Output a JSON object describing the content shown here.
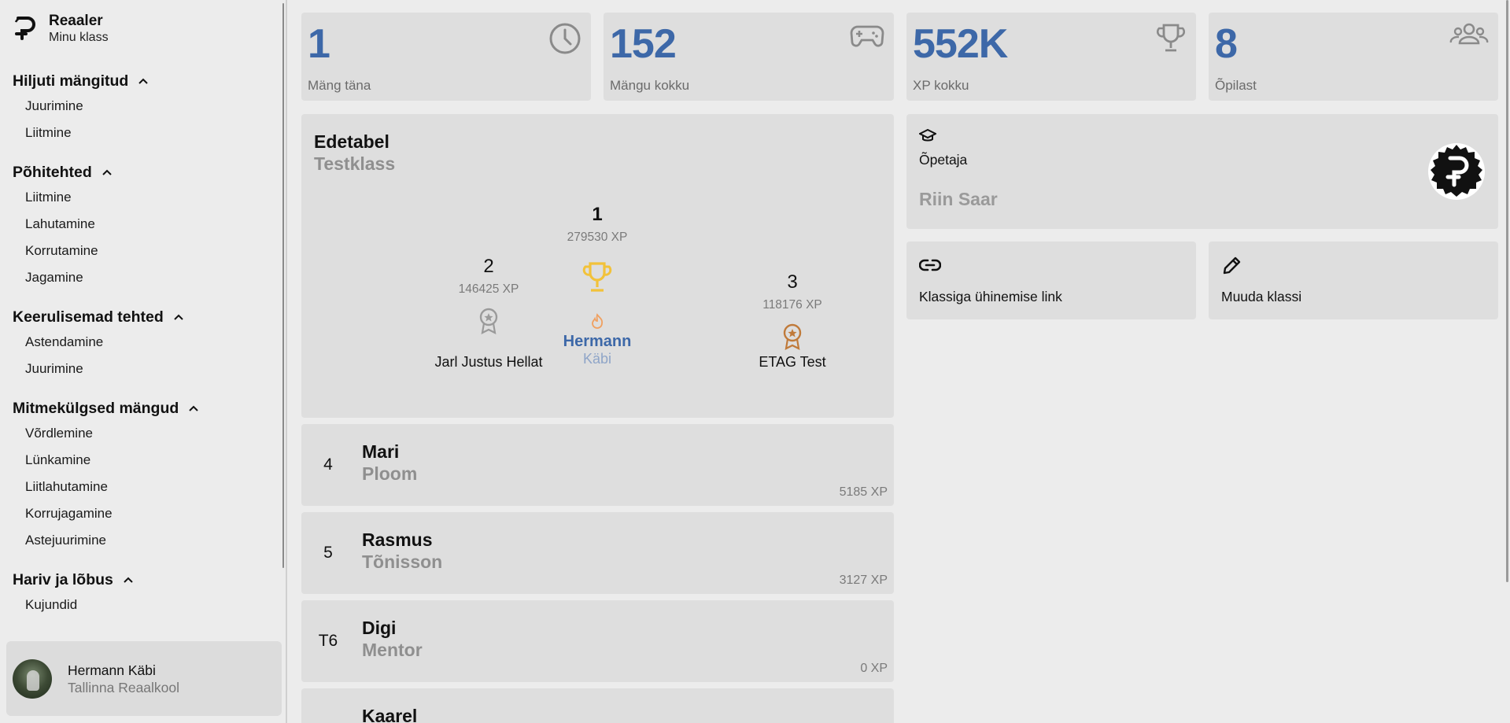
{
  "app": {
    "name": "Reaaler",
    "subtitle": "Minu klass"
  },
  "sidebar": {
    "groups": [
      {
        "title": "Hiljuti mängitud",
        "items": [
          "Juurimine",
          "Liitmine"
        ]
      },
      {
        "title": "Põhitehted",
        "items": [
          "Liitmine",
          "Lahutamine",
          "Korrutamine",
          "Jagamine"
        ]
      },
      {
        "title": "Keerulisemad tehted",
        "items": [
          "Astendamine",
          "Juurimine"
        ]
      },
      {
        "title": "Mitmekülgsed mängud",
        "items": [
          "Võrdlemine",
          "Lünkamine",
          "Liitlahutamine",
          "Korrujagamine",
          "Astejuurimine"
        ]
      },
      {
        "title": "Hariv ja lõbus",
        "items": [
          "Kujundid"
        ]
      }
    ]
  },
  "profile": {
    "name": "Hermann Käbi",
    "school": "Tallinna Reaalkool"
  },
  "stats": [
    {
      "value": "1",
      "label": "Mäng täna",
      "icon": "clock-icon"
    },
    {
      "value": "152",
      "label": "Mängu kokku",
      "icon": "gamepad-icon"
    },
    {
      "value": "552K",
      "label": "XP kokku",
      "icon": "trophy-icon"
    },
    {
      "value": "8",
      "label": "Õpilast",
      "icon": "people-icon"
    }
  ],
  "leaderboard": {
    "title": "Edetabel",
    "subtitle": "Testklass",
    "podium": {
      "first": {
        "rank": "1",
        "xp": "279530 XP",
        "first_name": "Hermann",
        "last_name": "Käbi"
      },
      "second": {
        "rank": "2",
        "xp": "146425 XP",
        "name": "Jarl Justus Hellat"
      },
      "third": {
        "rank": "3",
        "xp": "118176 XP",
        "name": "ETAG Test"
      }
    },
    "rows": [
      {
        "rank": "4",
        "first_name": "Mari",
        "last_name": "Ploom",
        "xp": "5185 XP"
      },
      {
        "rank": "5",
        "first_name": "Rasmus",
        "last_name": "Tõnisson",
        "xp": "3127 XP"
      },
      {
        "rank": "T6",
        "first_name": "Digi",
        "last_name": "Mentor",
        "xp": "0 XP"
      },
      {
        "rank": "",
        "first_name": "Kaarel",
        "last_name": "",
        "xp": ""
      }
    ]
  },
  "teacher": {
    "label": "Õpetaja",
    "name": "Riin Saar"
  },
  "actions": {
    "join_link": "Klassiga ühinemise link",
    "edit_class": "Muuda klassi"
  },
  "colors": {
    "accent_blue": "#3d68a8",
    "gold": "#f2c23a",
    "silver": "#9a9a9a",
    "bronze": "#c07a3a",
    "flame": "#f0a060"
  }
}
